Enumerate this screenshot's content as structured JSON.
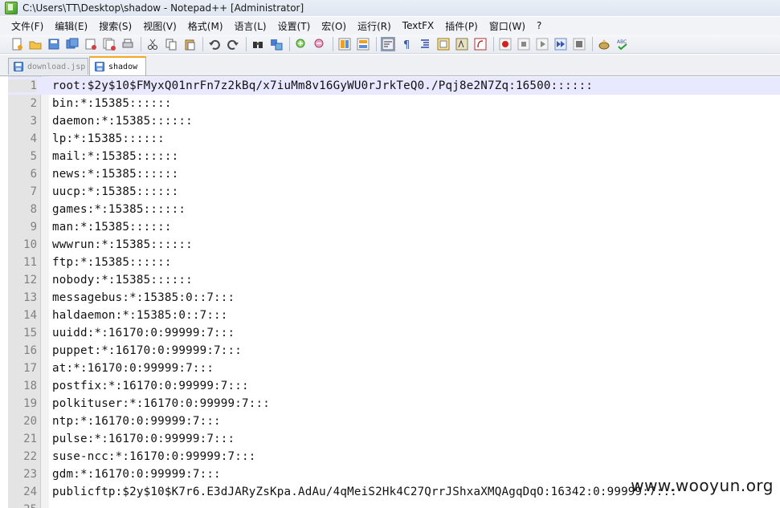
{
  "window": {
    "title": "C:\\Users\\TT\\Desktop\\shadow - Notepad++ [Administrator]"
  },
  "menu": [
    "文件(F)",
    "编辑(E)",
    "搜索(S)",
    "视图(V)",
    "格式(M)",
    "语言(L)",
    "设置(T)",
    "宏(O)",
    "运行(R)",
    "TextFX",
    "插件(P)",
    "窗口(W)",
    "?"
  ],
  "toolbar_icons": [
    "new-file-icon",
    "open-file-icon",
    "save-icon",
    "save-all-icon",
    "close-icon",
    "close-all-icon",
    "print-icon",
    "sep",
    "cut-icon",
    "copy-icon",
    "paste-icon",
    "sep",
    "undo-icon",
    "redo-icon",
    "sep",
    "find-icon",
    "replace-icon",
    "sep",
    "zoom-in-icon",
    "zoom-out-icon",
    "sep",
    "sync-vertical-icon",
    "sync-horizontal-icon",
    "sep",
    "word-wrap-icon",
    "show-all-chars-icon",
    "indent-guide-icon",
    "user-lang-icon",
    "doc-map-icon",
    "function-list-icon",
    "sep",
    "record-macro-icon",
    "stop-macro-icon",
    "play-macro-icon",
    "run-macro-multiple-icon",
    "save-macro-icon",
    "sep",
    "plugin-icon",
    "spell-check-icon"
  ],
  "tabs": [
    {
      "label": "download.jsp",
      "active": false
    },
    {
      "label": "shadow",
      "active": true
    }
  ],
  "editor": {
    "current_line": 1,
    "lines": [
      "root:$2y$10$FMyxQ01nrFn7z2kBq/x7iuMm8v16GyWU0rJrkTeQ0./Pqj8e2N7Zq:16500::::::",
      "bin:*:15385::::::",
      "daemon:*:15385::::::",
      "lp:*:15385::::::",
      "mail:*:15385::::::",
      "news:*:15385::::::",
      "uucp:*:15385::::::",
      "games:*:15385::::::",
      "man:*:15385::::::",
      "wwwrun:*:15385::::::",
      "ftp:*:15385::::::",
      "nobody:*:15385::::::",
      "messagebus:*:15385:0::7:::",
      "haldaemon:*:15385:0::7:::",
      "uuidd:*:16170:0:99999:7:::",
      "puppet:*:16170:0:99999:7:::",
      "at:*:16170:0:99999:7:::",
      "postfix:*:16170:0:99999:7:::",
      "polkituser:*:16170:0:99999:7:::",
      "ntp:*:16170:0:99999:7:::",
      "pulse:*:16170:0:99999:7:::",
      "suse-ncc:*:16170:0:99999:7:::",
      "gdm:*:16170:0:99999:7:::",
      "publicftp:$2y$10$K7r6.E3dJARyZsKpa.AdAu/4qMeiS2Hk4C27QrrJShxaXMQAgqDqO:16342:0:99999:7:::",
      ""
    ],
    "line_numbers": [
      "1",
      "2",
      "3",
      "4",
      "5",
      "6",
      "7",
      "8",
      "9",
      "10",
      "11",
      "12",
      "13",
      "14",
      "15",
      "16",
      "17",
      "18",
      "19",
      "20",
      "21",
      "22",
      "23",
      "24",
      "25"
    ]
  },
  "watermark": "www.wooyun.org"
}
